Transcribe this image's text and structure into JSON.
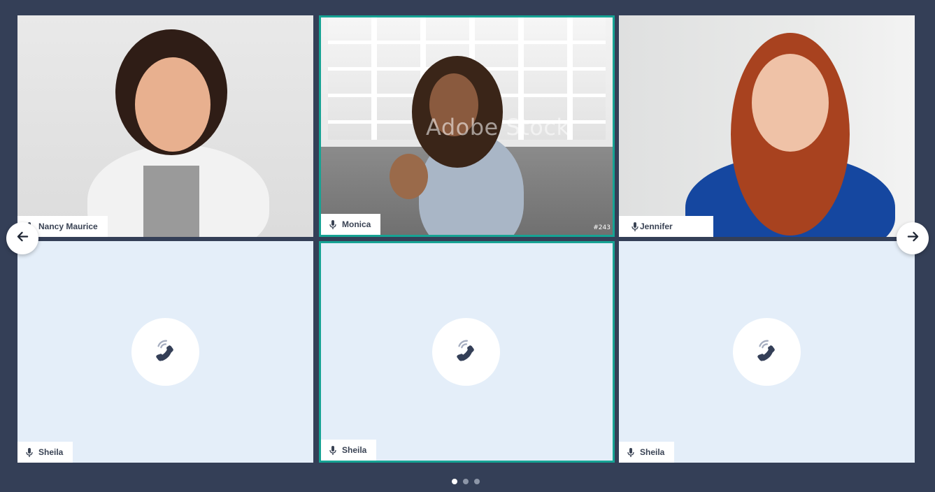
{
  "participants": [
    {
      "name": "Nancy Maurice",
      "has_video": true
    },
    {
      "name": "Monica",
      "has_video": true,
      "active": true,
      "watermark": "Adobe Stock",
      "frame_code": "#243"
    },
    {
      "name": "Jennifer",
      "has_video": true
    },
    {
      "name": "Sheila",
      "has_video": false
    },
    {
      "name": "Sheila",
      "has_video": false,
      "active": true
    },
    {
      "name": "Sheila",
      "has_video": false
    }
  ],
  "icons": {
    "mic": "microphone-icon",
    "calling": "phone-ringing-icon",
    "prev": "arrow-left-icon",
    "next": "arrow-right-icon"
  },
  "pagination": {
    "pages": 3,
    "current": 1
  },
  "colors": {
    "background": "#343f57",
    "active_border": "#16a394",
    "tile_empty": "#e4eef9",
    "text": "#3a4354"
  }
}
